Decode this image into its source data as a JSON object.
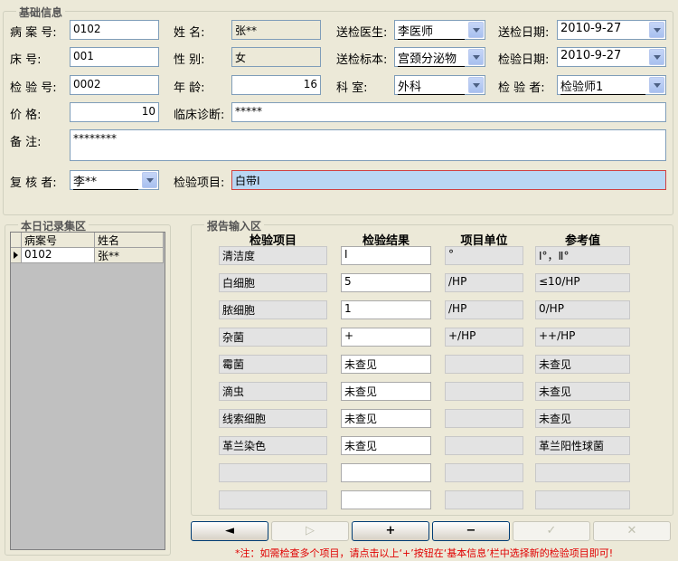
{
  "basic_info": {
    "title": "基础信息",
    "case_no": {
      "label": "病 案 号:",
      "value": "0102"
    },
    "name": {
      "label": "姓    名:",
      "value": "张**"
    },
    "doctor": {
      "label": "送检医生:",
      "value": "李医师"
    },
    "send_date": {
      "label": "送检日期:",
      "value": "2010-9-27"
    },
    "bed_no": {
      "label": "床    号:",
      "value": "001"
    },
    "gender": {
      "label": "性    别:",
      "value": "女"
    },
    "specimen": {
      "label": "送检标本:",
      "value": "宫颈分泌物"
    },
    "test_date": {
      "label": "检验日期:",
      "value": "2010-9-27"
    },
    "test_no": {
      "label": "检 验 号:",
      "value": "0002"
    },
    "age": {
      "label": "年    龄:",
      "value": "16"
    },
    "dept": {
      "label": "科    室:",
      "value": "外科"
    },
    "tester": {
      "label": "检 验 者:",
      "value": "检验师1"
    },
    "price": {
      "label": "价    格:",
      "value": "10"
    },
    "diagnosis": {
      "label": "临床诊断:",
      "value": "*****"
    },
    "remarks": {
      "label": "备    注:",
      "value": "********"
    },
    "reviewer": {
      "label": "复 核 者:",
      "value": "李**"
    },
    "test_item": {
      "label": "检验项目:",
      "value": "白带Ⅰ"
    }
  },
  "records": {
    "title": "本日记录集区",
    "headers": [
      "病案号",
      "姓名"
    ],
    "rows": [
      [
        "0102",
        "张**"
      ]
    ]
  },
  "report": {
    "title": "报告输入区",
    "headers": [
      "检验项目",
      "检验结果",
      "项目单位",
      "参考值"
    ],
    "rows": [
      [
        "清洁度",
        "Ⅰ",
        "°",
        "Ⅰ°，Ⅱ°"
      ],
      [
        "白细胞",
        "5",
        "/HP",
        "≤10/HP"
      ],
      [
        "脓细胞",
        "1",
        "/HP",
        "0/HP"
      ],
      [
        "杂菌",
        "+",
        "+/HP",
        "++/HP"
      ],
      [
        "霉菌",
        "未查见",
        "",
        "未查见"
      ],
      [
        "滴虫",
        "未查见",
        "",
        "未查见"
      ],
      [
        "线索细胞",
        "未查见",
        "",
        "未查见"
      ],
      [
        "革兰染色",
        "未查见",
        "",
        "革兰阳性球菌"
      ],
      [
        "",
        "",
        "",
        ""
      ],
      [
        "",
        "",
        "",
        ""
      ]
    ]
  },
  "nav": {
    "prev": "◄",
    "next": "▷",
    "add": "+",
    "remove": "−",
    "confirm": "✓",
    "cancel": "✕"
  },
  "note": "*注：如需检查多个项目，请点击以上‘+’按钮在‘基本信息’栏中选择新的检验项目即可!"
}
